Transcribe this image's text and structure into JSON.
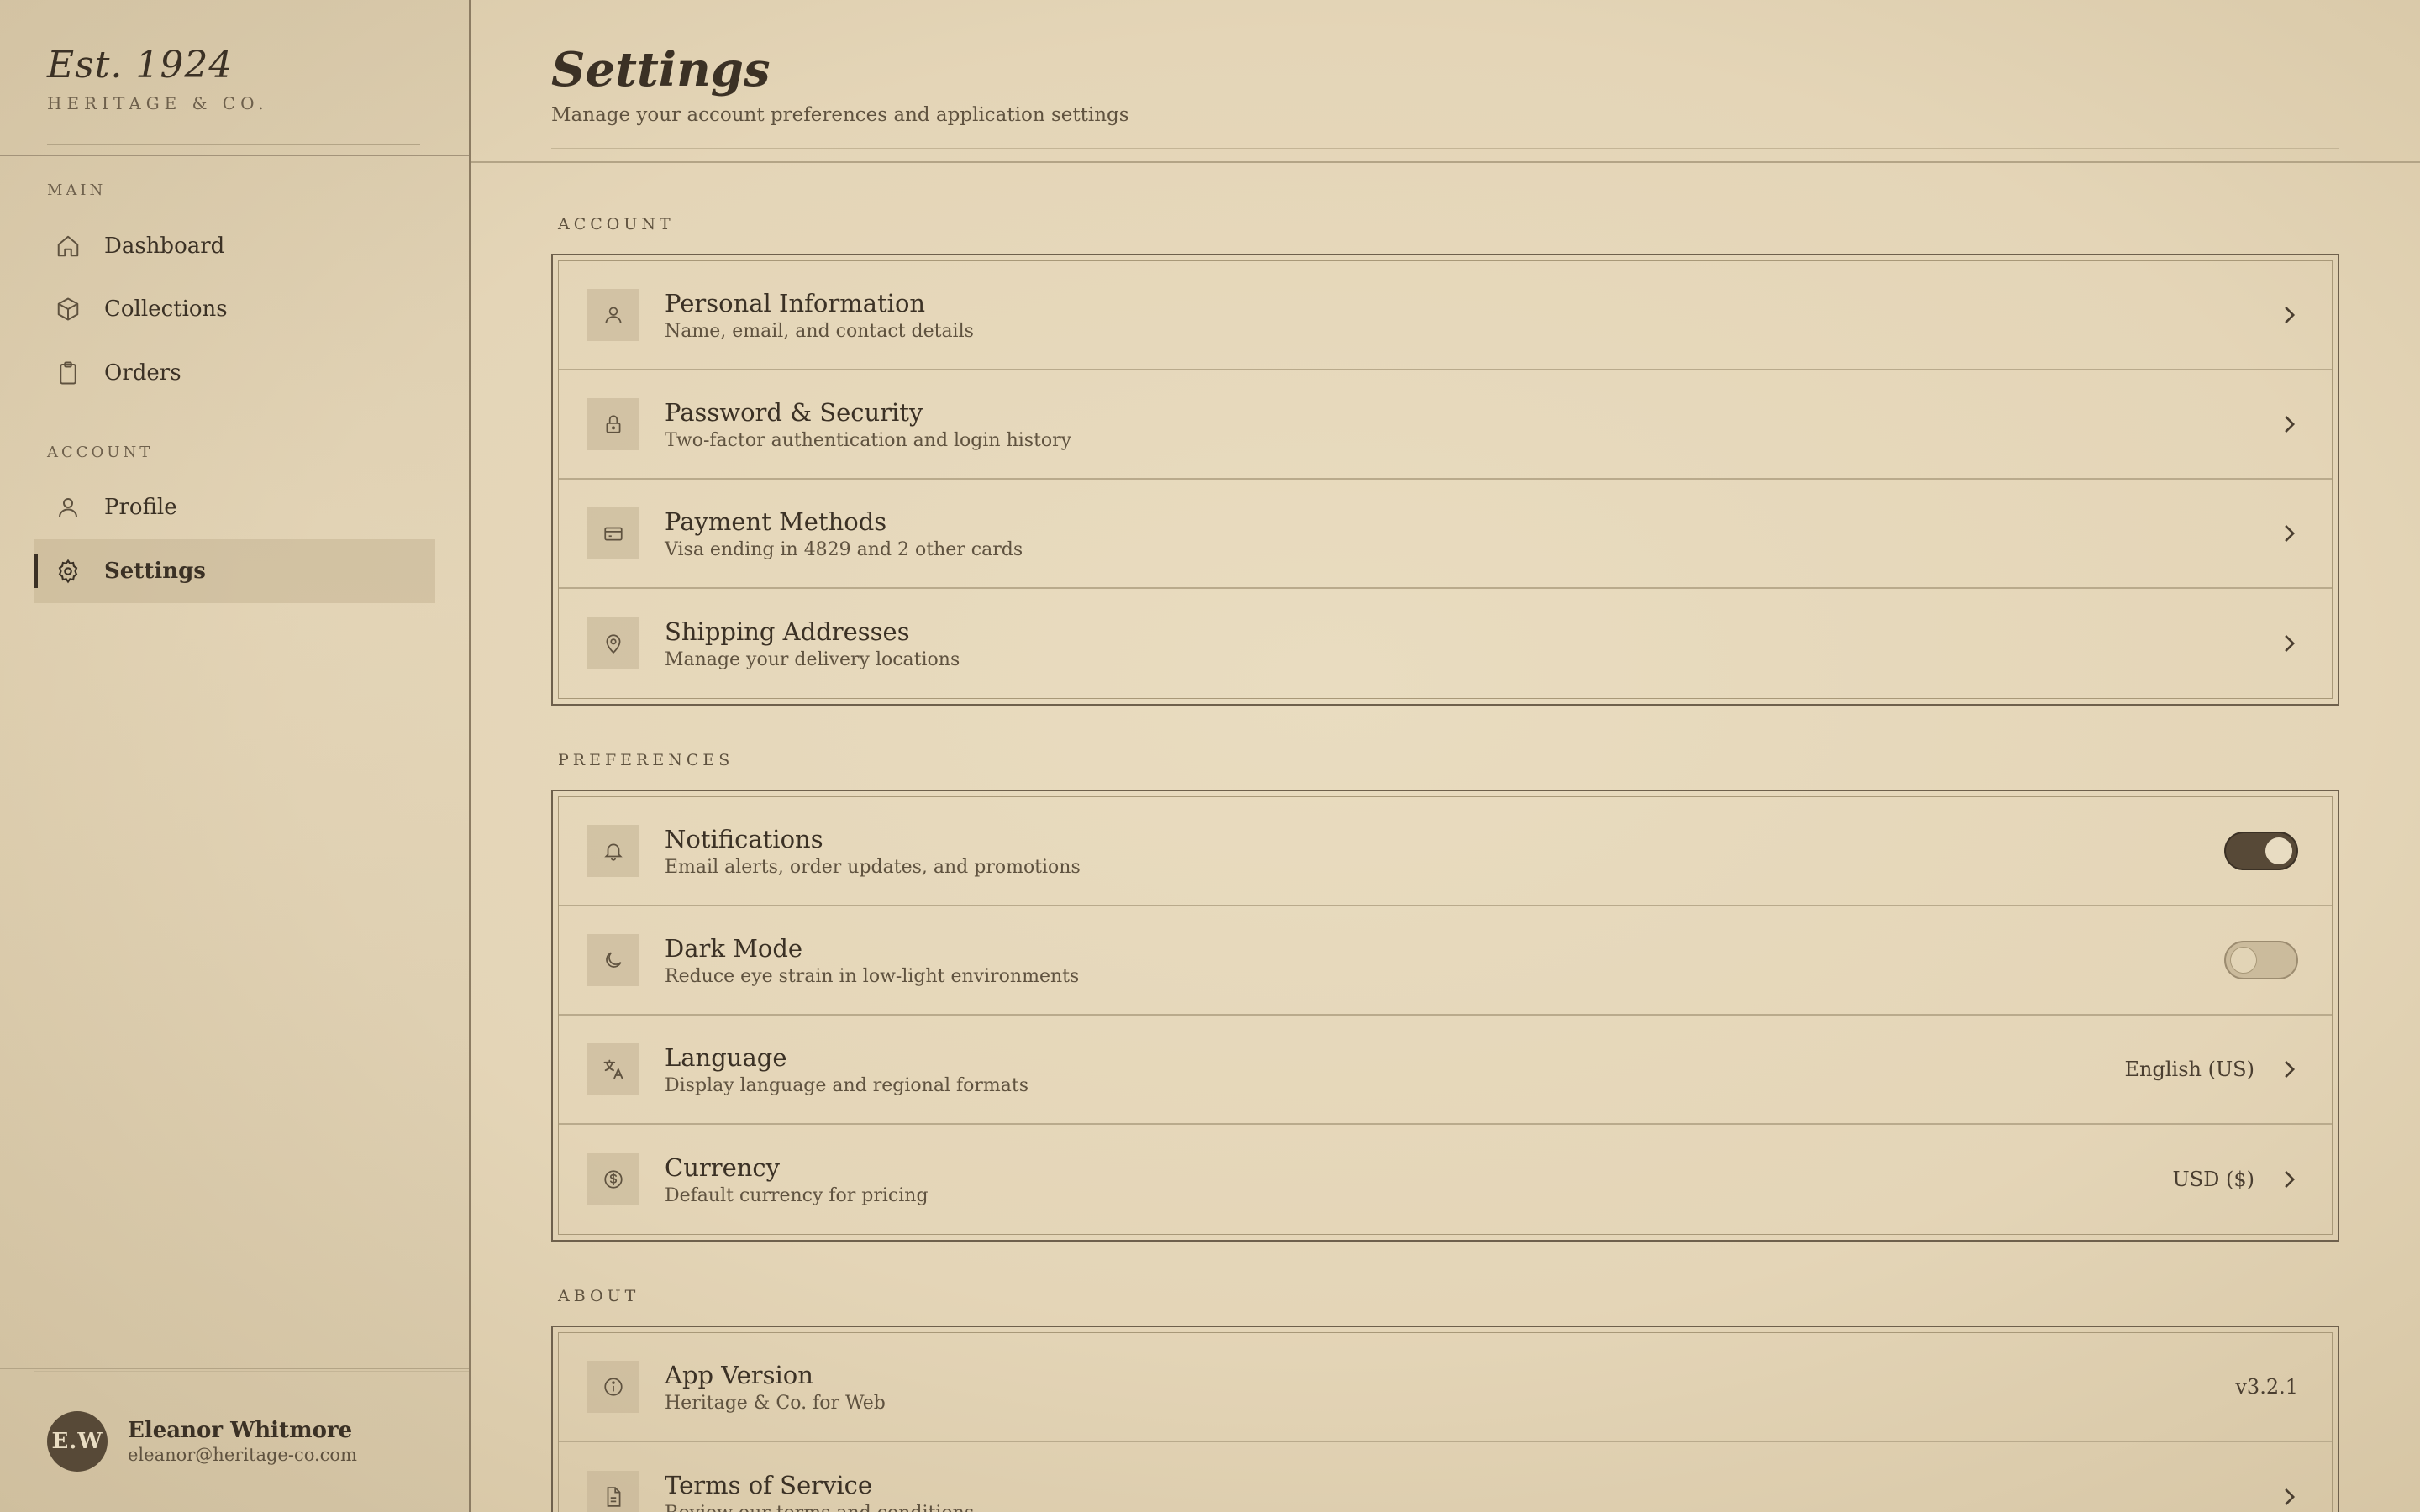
{
  "brand": {
    "title": "Est. 1924",
    "subtitle": "HERITAGE & CO."
  },
  "sidebar": {
    "sections": [
      {
        "label": "MAIN",
        "items": [
          {
            "label": "Dashboard",
            "icon": "home-icon",
            "active": false
          },
          {
            "label": "Collections",
            "icon": "box-icon",
            "active": false
          },
          {
            "label": "Orders",
            "icon": "clipboard-icon",
            "active": false
          }
        ]
      },
      {
        "label": "ACCOUNT",
        "items": [
          {
            "label": "Profile",
            "icon": "user-icon",
            "active": false
          },
          {
            "label": "Settings",
            "icon": "gear-icon",
            "active": true
          }
        ]
      }
    ],
    "user": {
      "initials": "E.W",
      "name": "Eleanor Whitmore",
      "email": "eleanor@heritage-co.com"
    }
  },
  "header": {
    "title": "Settings",
    "subtitle": "Manage your account preferences and application settings"
  },
  "sections": {
    "account": {
      "label": "ACCOUNT",
      "rows": [
        {
          "title": "Personal Information",
          "desc": "Name, email, and contact details",
          "icon": "user-icon"
        },
        {
          "title": "Password & Security",
          "desc": "Two-factor authentication and login history",
          "icon": "lock-icon"
        },
        {
          "title": "Payment Methods",
          "desc": "Visa ending in 4829 and 2 other cards",
          "icon": "credit-card-icon"
        },
        {
          "title": "Shipping Addresses",
          "desc": "Manage your delivery locations",
          "icon": "map-pin-icon"
        }
      ]
    },
    "preferences": {
      "label": "PREFERENCES",
      "rows": [
        {
          "title": "Notifications",
          "desc": "Email alerts, order updates, and promotions",
          "icon": "bell-icon",
          "toggle": true
        },
        {
          "title": "Dark Mode",
          "desc": "Reduce eye strain in low-light environments",
          "icon": "moon-icon",
          "toggle": false
        },
        {
          "title": "Language",
          "desc": "Display language and regional formats",
          "icon": "translate-icon",
          "value": "English (US)"
        },
        {
          "title": "Currency",
          "desc": "Default currency for pricing",
          "icon": "dollar-icon",
          "value": "USD ($)"
        }
      ]
    },
    "about": {
      "label": "ABOUT",
      "rows": [
        {
          "title": "App Version",
          "desc": "Heritage & Co. for Web",
          "icon": "info-icon",
          "value": "v3.2.1"
        },
        {
          "title": "Terms of Service",
          "desc": "Review our terms and conditions",
          "icon": "document-icon"
        }
      ]
    }
  },
  "colors": {
    "ink": "#3b3125",
    "accent": "#574937",
    "paper": "#e6d8bb"
  }
}
